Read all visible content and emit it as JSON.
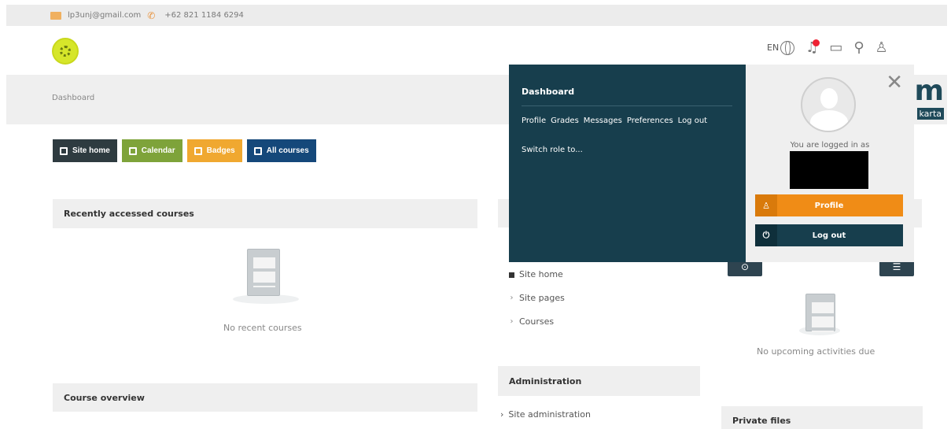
{
  "topbar": {
    "email": "lp3unj@gmail.com",
    "phone": "+62 821 1184 6294"
  },
  "header": {
    "lang": "EN",
    "brand_letter": "m",
    "brand_tag": "karta"
  },
  "breadcrumb": {
    "current": "Dashboard"
  },
  "quicklinks": {
    "site_home": "Site home",
    "calendar": "Calendar",
    "badges": "Badges",
    "all_courses": "All courses"
  },
  "blocks": {
    "recent_title": "Recently accessed courses",
    "recent_empty": "No recent courses",
    "overview_title": "Course overview",
    "upcoming_empty": "No upcoming activities due",
    "admin_title": "Administration",
    "site_admin": "Site administration",
    "private_files": "Private files"
  },
  "navigation": {
    "items": [
      "Site home",
      "Site pages",
      "Courses"
    ]
  },
  "usermenu": {
    "dashboard": "Dashboard",
    "links": [
      "Profile",
      "Grades",
      "Messages",
      "Preferences",
      "Log out"
    ],
    "switch_role": "Switch role to...",
    "logged_in_as": "You are logged in as",
    "profile_button": "Profile",
    "logout_button": "Log out"
  },
  "colors": {
    "popup_dark": "#173e4d",
    "orange": "#f08c16",
    "home_btn": "#2e3b40",
    "calendar_btn": "#7ea33a",
    "badges_btn": "#f0a830",
    "all_courses_btn": "#15487a"
  },
  "icons": {
    "email": "envelope-icon",
    "phone": "phone-icon",
    "language": "globe-icon",
    "notifications": "bell-icon",
    "messages": "chat-icon",
    "search": "search-icon",
    "user": "user-icon",
    "close": "close-icon"
  }
}
